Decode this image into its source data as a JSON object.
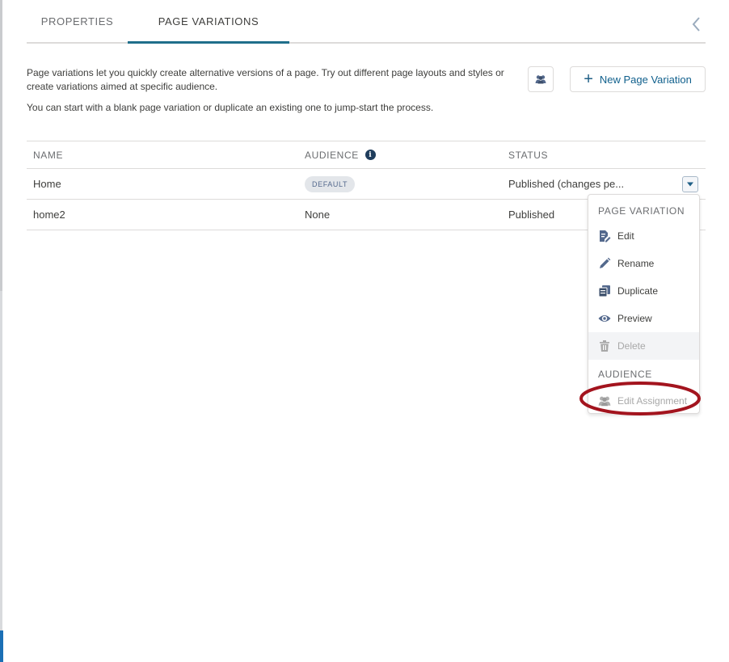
{
  "tabs": [
    {
      "label": "PROPERTIES",
      "active": false
    },
    {
      "label": "PAGE VARIATIONS",
      "active": true
    }
  ],
  "collapse_icon": "chevron-left-icon",
  "description": {
    "paragraph1": "Page variations let you quickly create alternative versions of a page. Try out different page layouts and styles or create variations aimed at specific audience.",
    "paragraph2": "You can start with a blank page variation or duplicate an existing one to jump-start the process."
  },
  "toolbar": {
    "audience_icon": "audience-icon",
    "new_variation_label": "New Page Variation"
  },
  "table": {
    "columns": [
      "NAME",
      "AUDIENCE",
      "STATUS"
    ],
    "rows": [
      {
        "name": "Home",
        "audience": "DEFAULT",
        "audience_is_badge": true,
        "status": "Published (changes pe..."
      },
      {
        "name": "home2",
        "audience": "None",
        "audience_is_badge": false,
        "status": "Published"
      }
    ]
  },
  "row_menu": {
    "section1_heading": "PAGE VARIATION",
    "items": [
      {
        "label": "Edit",
        "icon": "edit-page-icon",
        "disabled": false
      },
      {
        "label": "Rename",
        "icon": "pencil-icon",
        "disabled": false
      },
      {
        "label": "Duplicate",
        "icon": "duplicate-icon",
        "disabled": false
      },
      {
        "label": "Preview",
        "icon": "eye-icon",
        "disabled": false
      },
      {
        "label": "Delete",
        "icon": "trash-icon",
        "disabled": true
      }
    ],
    "section2_heading": "AUDIENCE",
    "audience_items": [
      {
        "label": "Edit Assignment",
        "icon": "audience-icon",
        "disabled": true
      }
    ]
  },
  "colors": {
    "accent": "#1f6f8b",
    "annotation": "#a3141e",
    "icon_dark": "#54698d"
  }
}
